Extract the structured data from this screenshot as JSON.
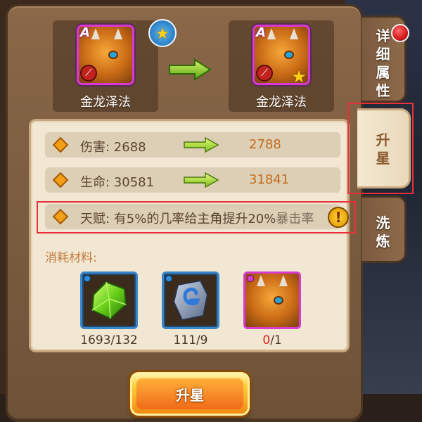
{
  "hero": {
    "before_name": "金龙泽法",
    "after_name": "金龙泽法",
    "grade": "A"
  },
  "stats": [
    {
      "label": "伤害: 2688",
      "new_value": "2788"
    },
    {
      "label": "生命: 30581",
      "new_value": "31841"
    }
  ],
  "talent": {
    "text": "天赋: 有5%的几率给主角提升20%",
    "trailing": "暴击率"
  },
  "materials": {
    "title": "消耗材料:",
    "items": [
      {
        "name": "green-gem",
        "have": "1693",
        "need": "/132",
        "insufficient": false
      },
      {
        "name": "blue-stone",
        "have": "111",
        "need": "/9",
        "insufficient": false
      },
      {
        "name": "dragon-card",
        "have": "0",
        "need": "/1",
        "insufficient": true
      }
    ]
  },
  "upgrade_button": "升星",
  "tabs": {
    "detail": [
      "详",
      "细",
      "属",
      "性"
    ],
    "star": [
      "升",
      "星"
    ],
    "wash": [
      "洗",
      "炼"
    ]
  },
  "colors": {
    "accent_orange": "#c46a1a",
    "highlight_red": "#e8313a",
    "grade_pink": "#d93ad0",
    "material_blue": "#3b86c8"
  }
}
